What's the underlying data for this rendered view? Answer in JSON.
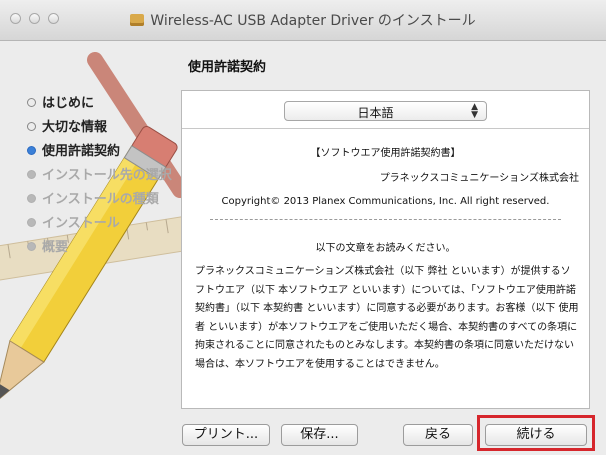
{
  "window": {
    "title": "Wireless-AC USB Adapter Driver のインストール"
  },
  "sidebar": {
    "steps": [
      {
        "label": "はじめに",
        "state": "done"
      },
      {
        "label": "大切な情報",
        "state": "done"
      },
      {
        "label": "使用許諾契約",
        "state": "active"
      },
      {
        "label": "インストール先の選択",
        "state": "pending"
      },
      {
        "label": "インストールの種類",
        "state": "pending"
      },
      {
        "label": "インストール",
        "state": "pending"
      },
      {
        "label": "概要",
        "state": "pending"
      }
    ]
  },
  "main": {
    "heading": "使用許諾契約",
    "language_select": {
      "selected": "日本語"
    },
    "license": {
      "title": "【ソフトウエア使用許諾契約書】",
      "company": "プラネックスコミュニケーションズ株式会社",
      "copyright": "Copyright© 2013 Planex Communications, Inc. All right reserved.",
      "read_prompt": "以下の文章をお読みください。",
      "body": "プラネックスコミュニケーションズ株式会社（以下 弊社 といいます）が提供するソフトウエア（以下 本ソフトウエア といいます）については、「ソフトウエア使用許諾契約書」（以下 本契約書 といいます）に同意する必要があります。お客様（以下 使用者 といいます）が本ソフトウエアをご使用いただく場合、本契約書のすべての条項に拘束されることに同意されたものとみなします。本契約書の条項に同意いただけない場合は、本ソフトウエアを使用することはできません。"
    }
  },
  "buttons": {
    "print": "プリント...",
    "save": "保存...",
    "back": "戻る",
    "continue": "続ける"
  },
  "colors": {
    "active_step": "#3b80d8",
    "highlight": "#d6262c"
  }
}
